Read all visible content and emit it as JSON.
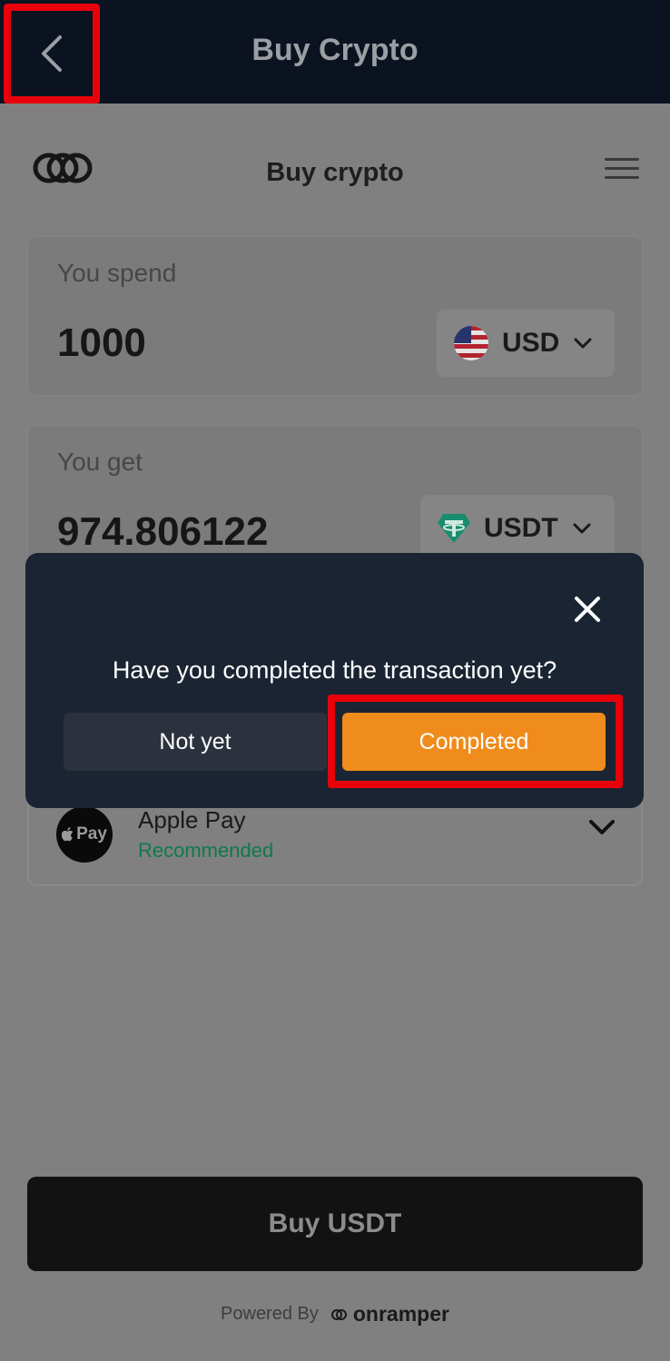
{
  "header": {
    "title": "Buy Crypto"
  },
  "widget": {
    "title": "Buy crypto",
    "spend": {
      "label": "You spend",
      "amount": "1000",
      "currency": "USD"
    },
    "get": {
      "label": "You get",
      "amount": "974.806122",
      "currency": "USDT"
    },
    "payment": {
      "method": "Apple Pay",
      "tag": "Recommended",
      "icon_text": "Pay"
    },
    "buy_button": "Buy USDT",
    "powered_by": "Powered By",
    "brand": "onramper"
  },
  "modal": {
    "question": "Have you completed the transaction yet?",
    "not_yet": "Not yet",
    "completed": "Completed"
  },
  "colors": {
    "accent": "#ef8c1b",
    "highlight": "#e8000b",
    "modal_bg": "#1b2432",
    "appbar_bg": "#0b1220"
  },
  "icons": [
    "back-chevron-icon",
    "onramper-logo-icon",
    "hamburger-menu-icon",
    "us-flag-icon",
    "tether-icon",
    "chevron-down-icon",
    "apple-pay-icon",
    "close-icon"
  ]
}
